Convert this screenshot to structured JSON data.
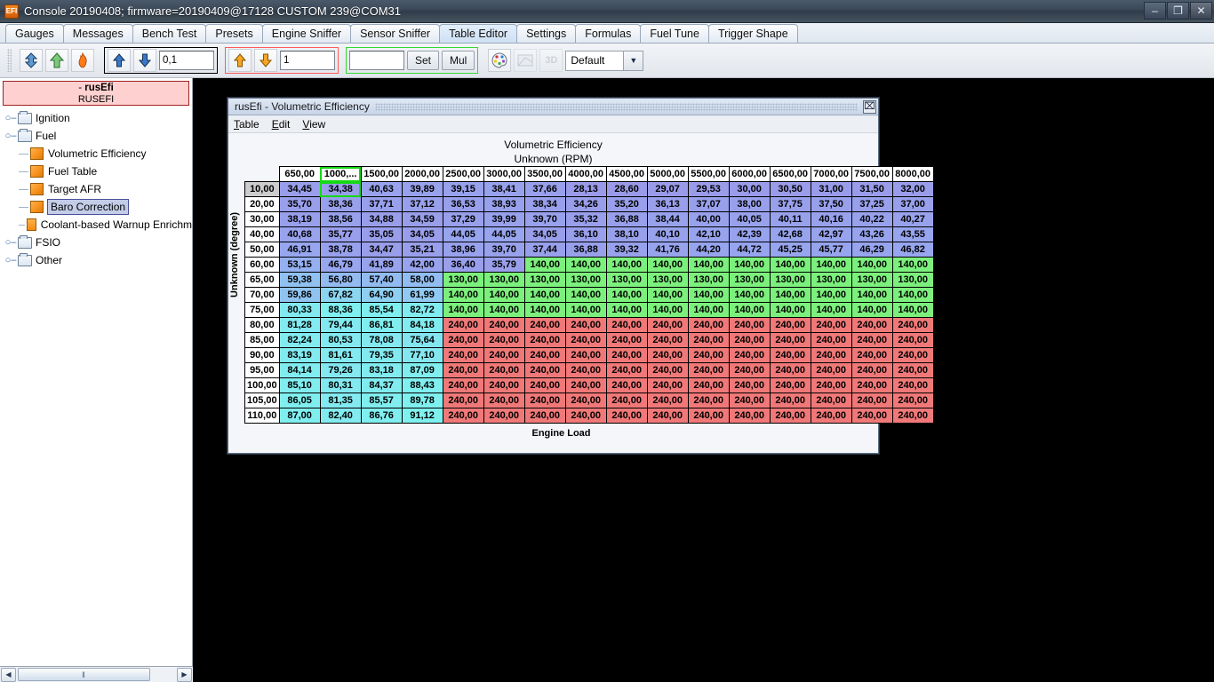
{
  "window": {
    "title": "Console 20190408; firmware=20190409@17128 CUSTOM 239@COM31",
    "app_icon": "efi-icon",
    "minimize": "–",
    "maximize": "❐",
    "close": "✕"
  },
  "tabs": [
    {
      "label": "Gauges",
      "active": false
    },
    {
      "label": "Messages",
      "active": false
    },
    {
      "label": "Bench Test",
      "active": false
    },
    {
      "label": "Presets",
      "active": false
    },
    {
      "label": "Engine Sniffer",
      "active": false
    },
    {
      "label": "Sensor Sniffer",
      "active": false
    },
    {
      "label": "Table Editor",
      "active": true
    },
    {
      "label": "Settings",
      "active": false
    },
    {
      "label": "Formulas",
      "active": false
    },
    {
      "label": "Fuel Tune",
      "active": false
    },
    {
      "label": "Trigger Shape",
      "active": false
    }
  ],
  "toolbar": {
    "icon_download": "download-arrow-icon",
    "icon_upload": "upload-arrow-icon",
    "icon_burn": "burn-flame-icon",
    "step_group": {
      "up": "increment-up-icon",
      "down": "increment-down-icon",
      "value": "0,1"
    },
    "page_group": {
      "up": "page-up-icon",
      "down": "page-down-icon",
      "value": "1"
    },
    "set_group": {
      "value": "",
      "placeholder": "",
      "set_label": "Set",
      "mul_label": "Mul"
    },
    "icon_palette": "color-palette-icon",
    "icon_table2d": "table-2d-icon",
    "icon_3d": "3d-view-icon",
    "preset": {
      "value": "Default",
      "arrow": "chevron-down-icon"
    }
  },
  "sidebar": {
    "header": {
      "line1_dash": "- ",
      "line1": "rusEfi",
      "line2": "RUSEFI"
    },
    "tree": [
      {
        "label": "Ignition",
        "type": "folder",
        "depth": 0,
        "expander": "○–",
        "selected": false
      },
      {
        "label": "Fuel",
        "type": "folder",
        "depth": 0,
        "expander": "○–",
        "selected": false
      },
      {
        "label": "Volumetric Efficiency",
        "type": "cube",
        "depth": 1,
        "expander": "",
        "selected": false
      },
      {
        "label": "Fuel Table",
        "type": "cube",
        "depth": 1,
        "expander": "",
        "selected": false
      },
      {
        "label": "Target AFR",
        "type": "cube",
        "depth": 1,
        "expander": "",
        "selected": false
      },
      {
        "label": "Baro Correction",
        "type": "cube",
        "depth": 1,
        "expander": "",
        "selected": true
      },
      {
        "label": "Coolant-based Warnup Enrichm",
        "type": "cube-flat",
        "depth": 1,
        "expander": "",
        "selected": false
      },
      {
        "label": "FSIO",
        "type": "folder",
        "depth": 0,
        "expander": "○–",
        "selected": false
      },
      {
        "label": "Other",
        "type": "folder",
        "depth": 0,
        "expander": "○–",
        "selected": false
      }
    ],
    "scrollbar": {
      "left_arrow": "◀",
      "right_arrow": "▶",
      "grip": "‖"
    }
  },
  "internal_window": {
    "title": "rusEfi - Volumetric Efficiency",
    "close": "⌧",
    "menu": [
      {
        "label": "Table",
        "accel": "T"
      },
      {
        "label": "Edit",
        "accel": "E"
      },
      {
        "label": "View",
        "accel": "V"
      }
    ]
  },
  "chart_data": {
    "type": "heatmap",
    "title": "Volumetric Efficiency",
    "subtitle": "Unknown (RPM)",
    "xlabel": "Engine Load",
    "ylabel": "Unknown (degree)",
    "selected_cell": {
      "row": 0,
      "col": 1
    },
    "selected_col_header": 1,
    "selected_row_header": 0,
    "colors": {
      "low": "#9b9be8",
      "mid": "#8fd4f0",
      "high": "#7ff0f0",
      "green": "#7cf07c",
      "red": "#f07878",
      "header_bg": "#ffffff",
      "header_sel_bg": "#cccccc",
      "selection_outline": "#16d816"
    },
    "columns": [
      "650,00",
      "1000,...",
      "1500,00",
      "2000,00",
      "2500,00",
      "3000,00",
      "3500,00",
      "4000,00",
      "4500,00",
      "5000,00",
      "5500,00",
      "6000,00",
      "6500,00",
      "7000,00",
      "7500,00",
      "8000,00"
    ],
    "rows": [
      "10,00",
      "20,00",
      "30,00",
      "40,00",
      "50,00",
      "60,00",
      "65,00",
      "70,00",
      "75,00",
      "80,00",
      "85,00",
      "90,00",
      "95,00",
      "100,00",
      "105,00",
      "110,00"
    ],
    "values": [
      [
        "34,45",
        "34,38",
        "40,63",
        "39,89",
        "39,15",
        "38,41",
        "37,66",
        "28,13",
        "28,60",
        "29,07",
        "29,53",
        "30,00",
        "30,50",
        "31,00",
        "31,50",
        "32,00"
      ],
      [
        "35,70",
        "38,36",
        "37,71",
        "37,12",
        "36,53",
        "38,93",
        "38,34",
        "34,26",
        "35,20",
        "36,13",
        "37,07",
        "38,00",
        "37,75",
        "37,50",
        "37,25",
        "37,00"
      ],
      [
        "38,19",
        "38,56",
        "34,88",
        "34,59",
        "37,29",
        "39,99",
        "39,70",
        "35,32",
        "36,88",
        "38,44",
        "40,00",
        "40,05",
        "40,11",
        "40,16",
        "40,22",
        "40,27"
      ],
      [
        "40,68",
        "35,77",
        "35,05",
        "34,05",
        "44,05",
        "44,05",
        "34,05",
        "36,10",
        "38,10",
        "40,10",
        "42,10",
        "42,39",
        "42,68",
        "42,97",
        "43,26",
        "43,55"
      ],
      [
        "46,91",
        "38,78",
        "34,47",
        "35,21",
        "38,96",
        "39,70",
        "37,44",
        "36,88",
        "39,32",
        "41,76",
        "44,20",
        "44,72",
        "45,25",
        "45,77",
        "46,29",
        "46,82"
      ],
      [
        "53,15",
        "46,79",
        "41,89",
        "42,00",
        "36,40",
        "35,79",
        "140,00",
        "140,00",
        "140,00",
        "140,00",
        "140,00",
        "140,00",
        "140,00",
        "140,00",
        "140,00",
        "140,00"
      ],
      [
        "59,38",
        "56,80",
        "57,40",
        "58,00",
        "130,00",
        "130,00",
        "130,00",
        "130,00",
        "130,00",
        "130,00",
        "130,00",
        "130,00",
        "130,00",
        "130,00",
        "130,00",
        "130,00"
      ],
      [
        "59,86",
        "67,82",
        "64,90",
        "61,99",
        "140,00",
        "140,00",
        "140,00",
        "140,00",
        "140,00",
        "140,00",
        "140,00",
        "140,00",
        "140,00",
        "140,00",
        "140,00",
        "140,00"
      ],
      [
        "80,33",
        "88,36",
        "85,54",
        "82,72",
        "140,00",
        "140,00",
        "140,00",
        "140,00",
        "140,00",
        "140,00",
        "140,00",
        "140,00",
        "140,00",
        "140,00",
        "140,00",
        "140,00"
      ],
      [
        "81,28",
        "79,44",
        "86,81",
        "84,18",
        "240,00",
        "240,00",
        "240,00",
        "240,00",
        "240,00",
        "240,00",
        "240,00",
        "240,00",
        "240,00",
        "240,00",
        "240,00",
        "240,00"
      ],
      [
        "82,24",
        "80,53",
        "78,08",
        "75,64",
        "240,00",
        "240,00",
        "240,00",
        "240,00",
        "240,00",
        "240,00",
        "240,00",
        "240,00",
        "240,00",
        "240,00",
        "240,00",
        "240,00"
      ],
      [
        "83,19",
        "81,61",
        "79,35",
        "77,10",
        "240,00",
        "240,00",
        "240,00",
        "240,00",
        "240,00",
        "240,00",
        "240,00",
        "240,00",
        "240,00",
        "240,00",
        "240,00",
        "240,00"
      ],
      [
        "84,14",
        "79,26",
        "83,18",
        "87,09",
        "240,00",
        "240,00",
        "240,00",
        "240,00",
        "240,00",
        "240,00",
        "240,00",
        "240,00",
        "240,00",
        "240,00",
        "240,00",
        "240,00"
      ],
      [
        "85,10",
        "80,31",
        "84,37",
        "88,43",
        "240,00",
        "240,00",
        "240,00",
        "240,00",
        "240,00",
        "240,00",
        "240,00",
        "240,00",
        "240,00",
        "240,00",
        "240,00",
        "240,00"
      ],
      [
        "86,05",
        "81,35",
        "85,57",
        "89,78",
        "240,00",
        "240,00",
        "240,00",
        "240,00",
        "240,00",
        "240,00",
        "240,00",
        "240,00",
        "240,00",
        "240,00",
        "240,00",
        "240,00"
      ],
      [
        "87,00",
        "82,40",
        "86,76",
        "91,12",
        "240,00",
        "240,00",
        "240,00",
        "240,00",
        "240,00",
        "240,00",
        "240,00",
        "240,00",
        "240,00",
        "240,00",
        "240,00",
        "240,00"
      ]
    ]
  }
}
